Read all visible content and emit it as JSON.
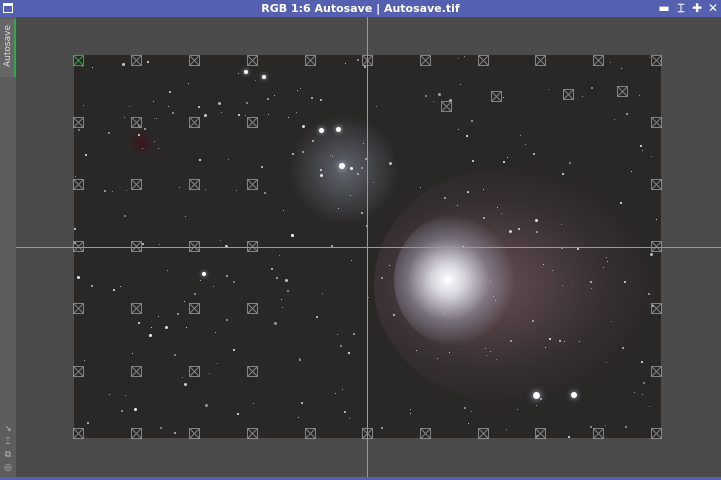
{
  "window": {
    "title": "RGB 1:6 Autosave | Autosave.tif",
    "buttons": [
      "minimize",
      "shade",
      "maximize",
      "close"
    ]
  },
  "sidebar": {
    "tab_label": "Autosave",
    "tools": [
      "fit-icon",
      "zoom-icon",
      "clone-icon",
      "target-icon"
    ]
  },
  "colors": {
    "titlebar": "#5560b0",
    "active_tab": "#2fa84a",
    "workspace": "#4b4b4b"
  }
}
